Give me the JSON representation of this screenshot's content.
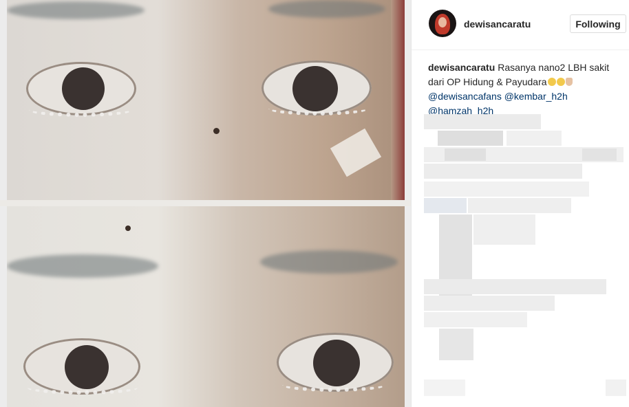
{
  "post": {
    "username": "dewisancaratu",
    "follow_label": "Following",
    "caption": {
      "username": "dewisancaratu",
      "text": "Rasanya nano2 LBH sakit dari OP Hidung & Payudara",
      "emojis": [
        "grinning-sweat-emoji",
        "grinning-sweat-emoji",
        "folded-hands-emoji"
      ],
      "mentions": [
        "@dewisancafans",
        "@kembar_h2h",
        "@hamzah_h2h"
      ]
    }
  },
  "colors": {
    "text": "#262626",
    "mention": "#003569",
    "border": "#dbdbdb"
  }
}
